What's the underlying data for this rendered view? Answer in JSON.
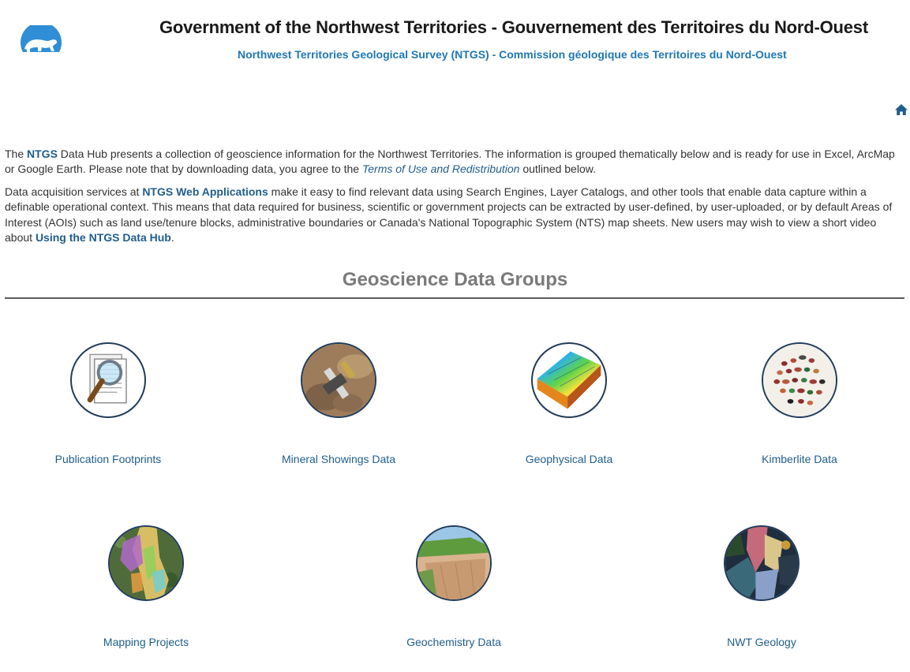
{
  "header": {
    "title": "Government of the Northwest Territories - Gouvernement des Territoires du Nord-Ouest",
    "subtitle": "Northwest Territories Geological Survey (NTGS) - Commission géologique des Territoires du Nord-Ouest"
  },
  "intro": {
    "p1_a": "The ",
    "p1_link": "NTGS",
    "p1_b": " Data Hub presents a collection of geoscience information for the Northwest Territories. The information is grouped thematically below and is ready for use in Excel, ArcMap or Google Earth. Please note that by downloading data, you agree to the ",
    "p1_terms": "Terms of Use and Redistribution",
    "p1_c": " outlined below.",
    "p2_a": "Data acquisition services at ",
    "p2_link": "NTGS Web Applications",
    "p2_b": " make it easy to find relevant data using Search Engines, Layer Catalogs, and other tools that enable data capture within a definable operational context. This means that data required for business, scientific or government projects can be extracted by user-defined, by user-uploaded, or by default Areas of Interest (AOIs) such as land use/tenure blocks, administrative boundaries or Canada's National Topographic System (NTS) map sheets. New users may wish to view a short video about ",
    "p2_video_link": "Using the NTGS Data Hub",
    "p2_c": "."
  },
  "section": {
    "title": "Geoscience Data Groups"
  },
  "cards": [
    {
      "label": "Publication Footprints",
      "icon": "magnifier-document-icon"
    },
    {
      "label": "Mineral Showings Data",
      "icon": "rock-hammer-icon"
    },
    {
      "label": "Geophysical Data",
      "icon": "geophysics-surface-icon"
    },
    {
      "label": "Kimberlite Data",
      "icon": "gemstones-icon"
    },
    {
      "label": "Mapping Projects",
      "icon": "aerial-map-icon"
    },
    {
      "label": "Geochemistry Data",
      "icon": "cliff-outcrop-icon"
    },
    {
      "label": "NWT Geology",
      "icon": "geology-map-icon"
    }
  ],
  "colors": {
    "brand_blue": "#1f77b4",
    "link_blue": "#1f5d8c",
    "heading_gray": "#7a7a7a",
    "logo_blue": "#2f8ed6"
  }
}
